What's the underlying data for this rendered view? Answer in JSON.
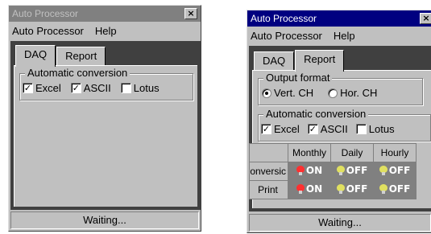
{
  "windows": [
    {
      "title": "Auto Processor",
      "close_glyph": "×",
      "menu": [
        "Auto Processor",
        "Help"
      ],
      "tabs": [
        "DAQ",
        "Report"
      ],
      "active_tab": "DAQ",
      "conversion_group": {
        "label": "Automatic conversion",
        "options": [
          {
            "label": "Excel",
            "checked": true
          },
          {
            "label": "ASCII",
            "checked": true
          },
          {
            "label": "Lotus",
            "checked": false
          }
        ]
      },
      "status": "Waiting..."
    },
    {
      "title": "Auto Processor",
      "close_glyph": "×",
      "menu": [
        "Auto Processor",
        "Help"
      ],
      "tabs": [
        "DAQ",
        "Report"
      ],
      "active_tab": "Report",
      "output_format": {
        "label": "Output format",
        "options": [
          {
            "label": "Vert. CH",
            "selected": true
          },
          {
            "label": "Hor. CH",
            "selected": false
          }
        ]
      },
      "conversion_group": {
        "label": "Automatic conversion",
        "options": [
          {
            "label": "Excel",
            "checked": true
          },
          {
            "label": "ASCII",
            "checked": true
          },
          {
            "label": "Lotus",
            "checked": false
          }
        ]
      },
      "schedule_table": {
        "columns": [
          "Monthly",
          "Daily",
          "Hourly"
        ],
        "rows": [
          {
            "label": "onversic",
            "cells": [
              {
                "text": "ON",
                "state": "on"
              },
              {
                "text": "OFF",
                "state": "off"
              },
              {
                "text": "OFF",
                "state": "off"
              }
            ]
          },
          {
            "label": "Print",
            "cells": [
              {
                "text": "ON",
                "state": "on"
              },
              {
                "text": "OFF",
                "state": "off"
              },
              {
                "text": "OFF",
                "state": "off"
              }
            ]
          }
        ]
      },
      "status": "Waiting..."
    }
  ],
  "colors": {
    "lamp_on": "#ff3030",
    "lamp_off": "#e0e060",
    "inactive_title": "#808080",
    "active_title": "#000080"
  }
}
